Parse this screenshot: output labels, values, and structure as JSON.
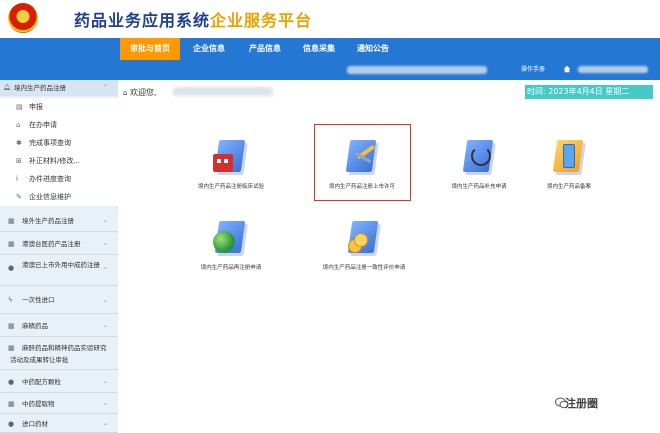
{
  "header": {
    "title_main": "药品业务应用系统",
    "title_sub": "企业服务平台"
  },
  "nav": {
    "tabs": [
      {
        "label": "审批与首页",
        "active": true
      },
      {
        "label": "企业信息"
      },
      {
        "label": "产品信息"
      },
      {
        "label": "信息采集"
      },
      {
        "label": "通知公告"
      }
    ],
    "manual_label": "操作手册"
  },
  "sidebar": {
    "top_group": "境内生产药品注册",
    "items": [
      {
        "label": "申报",
        "icon": "file-icon"
      },
      {
        "label": "在办申请",
        "icon": "bookmark-icon"
      },
      {
        "label": "完成事项查询",
        "icon": "gear-icon"
      },
      {
        "label": "补正材料/修改...",
        "icon": "plus-square-icon"
      },
      {
        "label": "办件进度查询",
        "icon": "info-icon"
      },
      {
        "label": "企业信息维护",
        "icon": "edit-icon"
      }
    ],
    "sections": [
      {
        "label": "境外生产药品注册",
        "icon": "folder-icon"
      },
      {
        "label": "港澳台医药产品注册",
        "icon": "folder-icon"
      },
      {
        "label": "港澳已上市外用中成药注册",
        "icon": "globe-icon"
      },
      {
        "label": "一次性进口",
        "icon": "bolt-icon"
      },
      {
        "label": "麻精药品",
        "icon": "folder-icon"
      },
      {
        "label": "麻醉药品和精神药品实验研究活动及成果转让审批",
        "icon": "folder-icon"
      },
      {
        "label": "中药配方颗粒",
        "icon": "globe-icon"
      },
      {
        "label": "中药提取物",
        "icon": "folder-icon"
      },
      {
        "label": "进口药材",
        "icon": "globe-icon"
      }
    ]
  },
  "main": {
    "welcome": "欢迎您,",
    "time": "时间: 2023年4月4日 星期二",
    "apps": [
      {
        "label": "境内生产药品注册临床试验",
        "icon": "building-icon"
      },
      {
        "label": "境内生产药品注册上市许可",
        "icon": "tools-icon",
        "highlighted": true
      },
      {
        "label": "境内生产药品补充申请",
        "icon": "stethoscope-icon"
      },
      {
        "label": "境内生产药品备案",
        "icon": "phone-icon"
      },
      {
        "label": "境内生产药品再注册申请",
        "icon": "globe-icon"
      },
      {
        "label": "境内生产药品注册一致性评价申请",
        "icon": "coins-icon"
      }
    ]
  },
  "watermark": "注册圈",
  "colors": {
    "nav_blue": "#2478d4",
    "active_tab": "#ff9900",
    "title_blue": "#1f3f8f",
    "title_gold": "#e8a200",
    "time_bg": "#44c9c6",
    "highlight_red": "#e0302a"
  }
}
